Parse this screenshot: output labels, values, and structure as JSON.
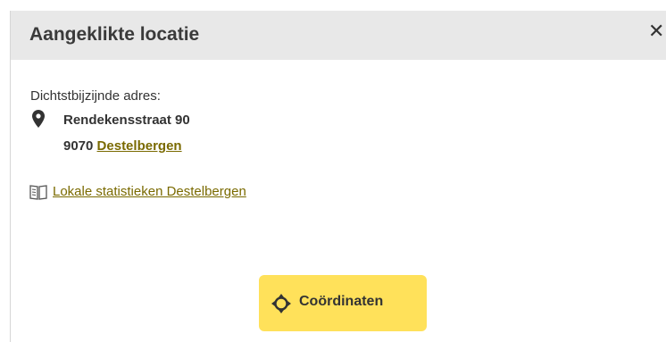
{
  "panel": {
    "title": "Aangeklikte locatie",
    "close_label": "✕"
  },
  "address": {
    "nearest_label": "Dichtstbijzijnde adres:",
    "street": "Rendekensstraat 90",
    "postal_code": "9070",
    "municipality": "Destelbergen"
  },
  "stats": {
    "link_label": "Lokale statistieken Destelbergen"
  },
  "coordinates_button": {
    "label": "Coördinaten"
  },
  "icons": {
    "close": "close-icon",
    "pin": "map-pin-icon",
    "book": "book-icon",
    "crosshair": "crosshair-icon"
  },
  "colors": {
    "header_bg": "#e8e8e8",
    "link": "#7a6a00",
    "button_bg": "#ffe15a",
    "text": "#333333"
  }
}
